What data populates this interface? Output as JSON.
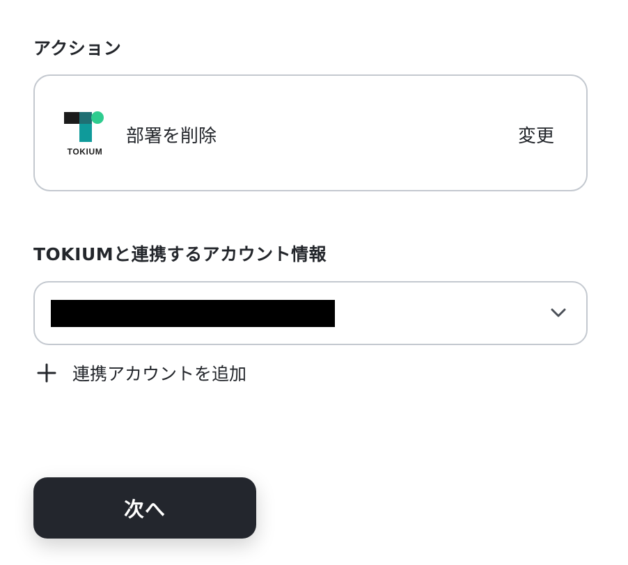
{
  "action_section": {
    "label": "アクション",
    "app_logo": {
      "icon": "tokium-logo",
      "text": "TOKIUM",
      "colors": {
        "dark": "#1b1b1b",
        "teal": "#0f9a9a",
        "green": "#2ecc8f"
      }
    },
    "action_name": "部署を削除",
    "change_label": "変更"
  },
  "account_section": {
    "label": "TOKIUMと連携するアカウント情報",
    "selected_value": "",
    "redacted": true,
    "dropdown_icon": "chevron-down-icon",
    "add_account_icon": "plus-icon",
    "add_account_label": "連携アカウントを追加"
  },
  "footer": {
    "next_label": "次へ"
  },
  "colors": {
    "text": "#23262b",
    "border": "#c3c8cf",
    "button_bg": "#23262d",
    "button_text": "#ffffff"
  }
}
